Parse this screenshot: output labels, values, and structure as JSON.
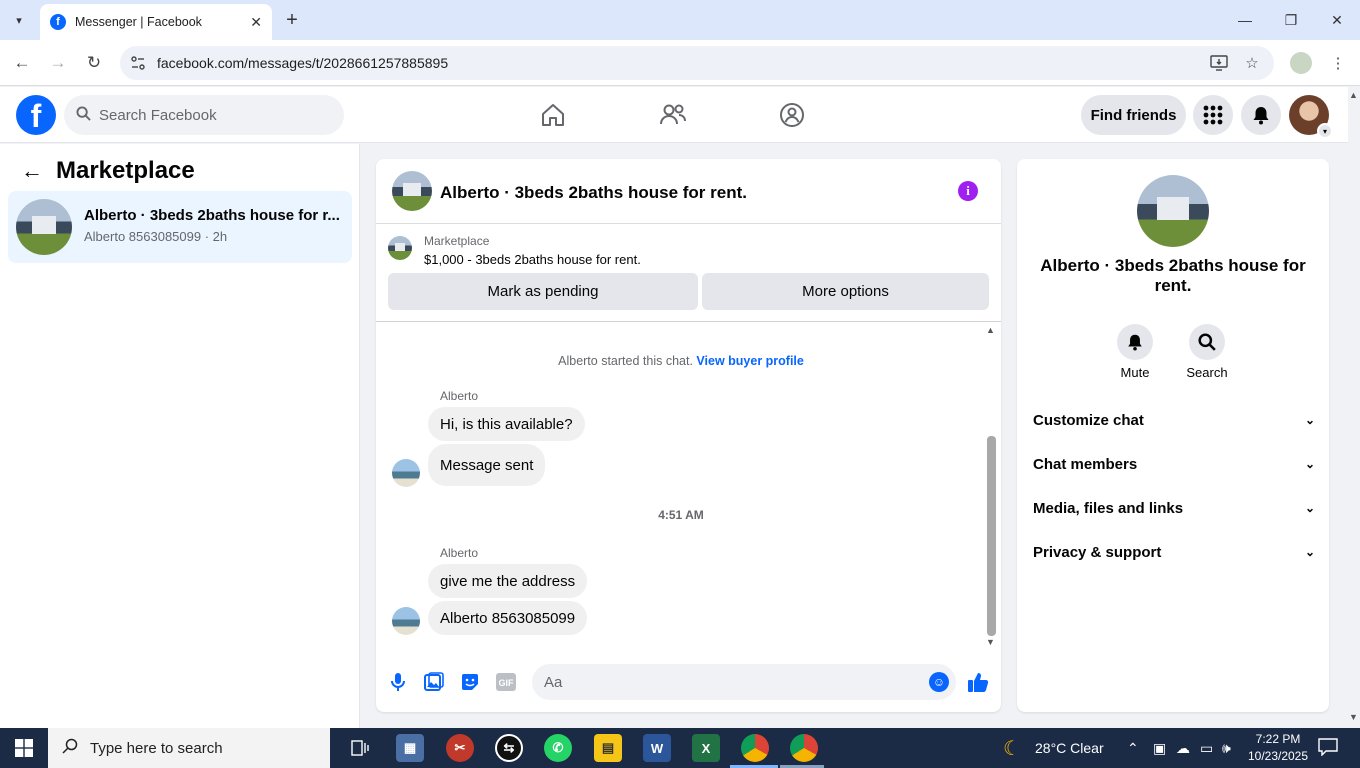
{
  "browser": {
    "tab_title": "Messenger | Facebook",
    "url": "facebook.com/messages/t/2028661257885895"
  },
  "fb": {
    "search_placeholder": "Search Facebook",
    "find_friends": "Find friends"
  },
  "left": {
    "title": "Marketplace",
    "conversation": {
      "name": "Alberto · 3beds 2baths house for r...",
      "subtitle": "Alberto 8563085099 · 2h"
    }
  },
  "chat": {
    "title": "Alberto · 3beds 2baths house for rent.",
    "listing_label": "Marketplace",
    "listing_price": "$1,000 - 3beds 2baths house for rent.",
    "mark_pending": "Mark as pending",
    "more_options": "More options",
    "system_message": "Alberto started this chat.",
    "view_profile": "View buyer profile",
    "groups": [
      {
        "sender": "Alberto",
        "messages": [
          "Hi, is this available?",
          "Message sent"
        ]
      },
      {
        "sender": "Alberto",
        "messages": [
          "give me the address",
          "Alberto 8563085099"
        ]
      }
    ],
    "timestamp": "4:51 AM",
    "composer_placeholder": "Aa"
  },
  "right": {
    "name": "Alberto · 3beds 2baths house for rent.",
    "mute": "Mute",
    "search": "Search",
    "sections": [
      "Customize chat",
      "Chat members",
      "Media, files and links",
      "Privacy & support"
    ]
  },
  "taskbar": {
    "search_placeholder": "Type here to search",
    "weather": "28°C  Clear",
    "time": "7:22 PM",
    "date": "10/23/2025"
  },
  "colors": {
    "accent": "#0866ff",
    "selected_row": "#ebf5ff",
    "info_purple": "#a020f0"
  }
}
